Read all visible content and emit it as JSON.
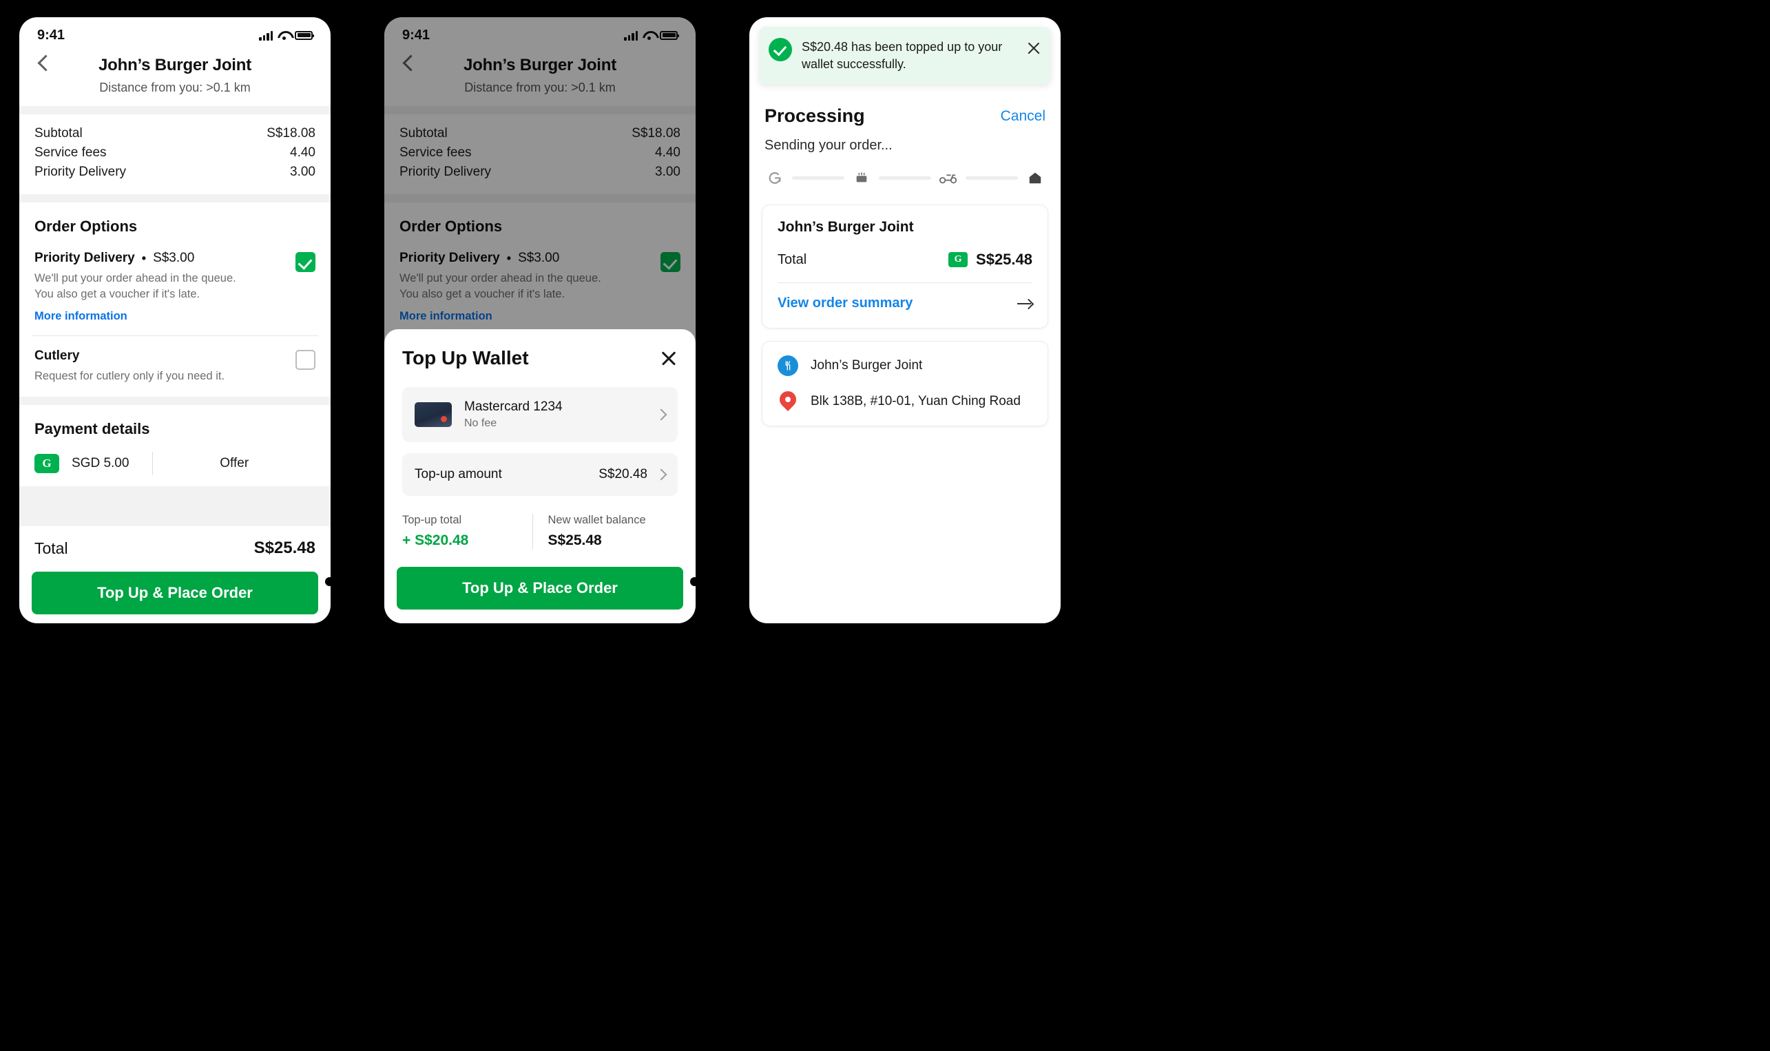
{
  "status_bar": {
    "time": "9:41"
  },
  "screen1": {
    "nav": {
      "title": "John’s Burger Joint",
      "subtitle": "Distance from you: >0.1 km",
      "back_icon": "chevron-left-icon"
    },
    "fees": [
      {
        "label": "Subtotal",
        "value": "S$18.08"
      },
      {
        "label": "Service fees",
        "value": "4.40"
      },
      {
        "label": "Priority Delivery",
        "value": "3.00"
      }
    ],
    "order_options": {
      "title": "Order Options",
      "priority": {
        "name": "Priority Delivery",
        "separator": "•",
        "price": "S$3.00",
        "description": "We'll put your order ahead in the queue. You also get a voucher if it's late.",
        "link": "More information",
        "checked": true
      },
      "cutlery": {
        "name": "Cutlery",
        "description": "Request for cutlery only if you need it.",
        "checked": false
      }
    },
    "payment": {
      "title": "Payment details",
      "wallet_label": "SGD 5.00",
      "wallet_icon": "G",
      "offer_label": "Offer"
    },
    "total": {
      "label": "Total",
      "value": "S$25.48"
    },
    "cta": "Top Up & Place Order"
  },
  "screen2": {
    "sheet": {
      "title": "Top Up Wallet",
      "close_icon": "close-icon",
      "card": {
        "name": "Mastercard 1234",
        "sub": "No fee"
      },
      "amount": {
        "label": "Top-up amount",
        "value": "S$20.48"
      },
      "totals": [
        {
          "label": "Top-up total",
          "value": "+ S$20.48",
          "accent": true
        },
        {
          "label": "New wallet balance",
          "value": "S$25.48",
          "accent": false
        }
      ],
      "cta": "Top Up & Place Order"
    }
  },
  "screen3": {
    "toast": {
      "message": "S$20.48 has been topped up to your wallet successfully.",
      "icon": "success-check-icon",
      "close_icon": "close-icon"
    },
    "header": {
      "title": "Processing",
      "cancel": "Cancel",
      "subtitle": "Sending your order..."
    },
    "tracker": [
      {
        "icon": "grab-g-icon",
        "glyph": "G"
      },
      {
        "icon": "cooking-pot-icon",
        "glyph": "▥"
      },
      {
        "icon": "scooter-icon",
        "glyph": "🛵"
      },
      {
        "icon": "home-icon",
        "glyph": "⌂"
      }
    ],
    "order_card": {
      "merchant": "John’s Burger Joint",
      "total_label": "Total",
      "total_value": "S$25.48",
      "wallet_icon": "G",
      "summary_link": "View order summary",
      "arrow_icon": "arrow-right-icon"
    },
    "address_card": {
      "merchant_name": "John’s Burger Joint",
      "merchant_icon": "restaurant-pin-icon",
      "address": "Blk 138B, #10-01, Yuan Ching Road",
      "address_icon": "location-pin-icon"
    }
  },
  "colors": {
    "brand_green": "#00B14F",
    "cta_green": "#00A544",
    "link_blue": "#0b72e7",
    "toast_bg": "#e8f8ee"
  }
}
